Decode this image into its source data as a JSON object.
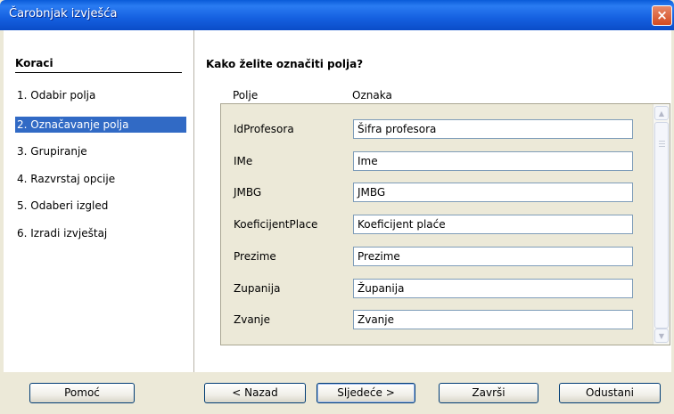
{
  "window": {
    "title": "Čarobnjak izvješća",
    "close_icon": "×"
  },
  "sidebar": {
    "title": "Koraci",
    "steps": [
      "1. Odabir polja",
      "2. Označavanje polja",
      "3. Grupiranje",
      "4. Razvrstaj opcije",
      "5. Odaberi izgled",
      "6. Izradi izvještaj"
    ],
    "active_index": 1
  },
  "main": {
    "question": "Kako želite označiti polja?",
    "column_field": "Polje",
    "column_label": "Oznaka",
    "rows": [
      {
        "field": "IdProfesora",
        "label": "Šifra profesora"
      },
      {
        "field": "IMe",
        "label": "Ime"
      },
      {
        "field": "JMBG",
        "label": "JMBG"
      },
      {
        "field": "KoeficijentPlace",
        "label": "Koeficijent plaće"
      },
      {
        "field": "Prezime",
        "label": "Prezime"
      },
      {
        "field": "Zupanija",
        "label": "Županija"
      },
      {
        "field": "Zvanje",
        "label": "Zvanje"
      }
    ]
  },
  "buttons": {
    "help": "Pomoć",
    "back": "< Nazad",
    "next": "Sljedeće >",
    "finish": "Završi",
    "cancel": "Odustani"
  },
  "icons": {
    "scroll_up": "scroll-up-icon",
    "scroll_down": "scroll-down-icon"
  },
  "colors": {
    "titlebar": "#0a5bd8",
    "selection": "#316ac5",
    "dialog_bg": "#ece9d8"
  }
}
